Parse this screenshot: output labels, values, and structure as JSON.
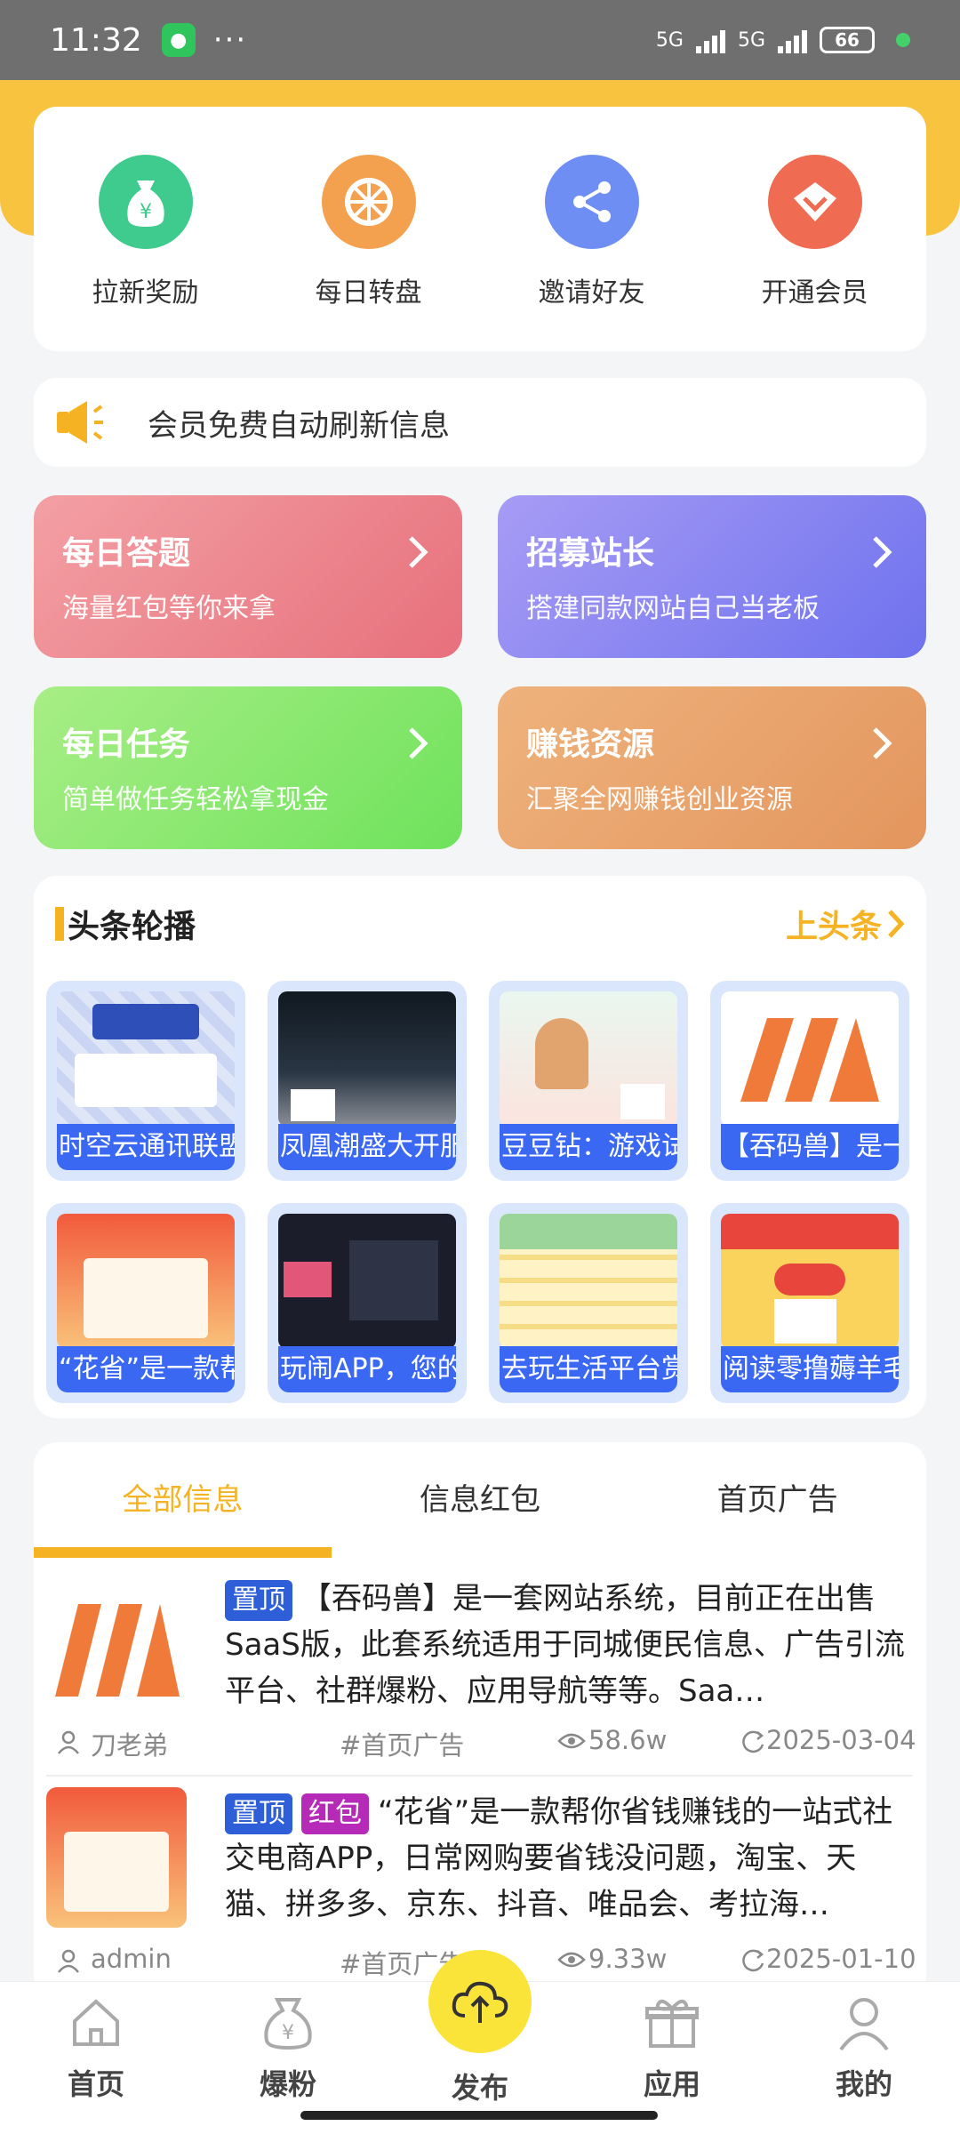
{
  "status": {
    "time": "11:32",
    "network1": "5G",
    "network2": "5G",
    "battery": "66"
  },
  "quick_actions": [
    {
      "label": "拉新奖励",
      "icon": "money-bag-icon",
      "color": "#3ecb8d"
    },
    {
      "label": "每日转盘",
      "icon": "wheel-icon",
      "color": "#f3a14e"
    },
    {
      "label": "邀请好友",
      "icon": "share-icon",
      "color": "#6f8ef3"
    },
    {
      "label": "开通会员",
      "icon": "diamond-icon",
      "color": "#ef6b52"
    }
  ],
  "notice": {
    "text": "会员免费自动刷新信息"
  },
  "tiles": [
    {
      "title": "每日答题",
      "subtitle": "海量红包等你来拿",
      "color": "#ee7f84"
    },
    {
      "title": "招募站长",
      "subtitle": "搭建同款网站自己当老板",
      "color": "#8c86f3"
    },
    {
      "title": "每日任务",
      "subtitle": "简单做任务轻松拿现金",
      "color": "#7ee267"
    },
    {
      "title": "赚钱资源",
      "subtitle": "汇聚全网赚钱创业资源",
      "color": "#e9a468"
    }
  ],
  "headline": {
    "title": "头条轮播",
    "more": "上头条",
    "items": [
      {
        "caption": "时空云通讯联盟"
      },
      {
        "caption": "凤凰潮盛大开服"
      },
      {
        "caption": "豆豆钻：游戏试玩"
      },
      {
        "caption": "【吞码兽】是一套"
      },
      {
        "caption": "“花省”是一款帮"
      },
      {
        "caption": "玩闹APP，您的"
      },
      {
        "caption": "去玩生活平台赏"
      },
      {
        "caption": "阅读零撸薅羊毛"
      }
    ]
  },
  "tabs": [
    {
      "label": "全部信息",
      "active": true
    },
    {
      "label": "信息红包",
      "active": false
    },
    {
      "label": "首页广告",
      "active": false
    }
  ],
  "posts": [
    {
      "badges": [
        "置顶"
      ],
      "text": "【吞码兽】是一套网站系统，目前正在出售SaaS版，此套系统适用于同城便民信息、广告引流平台、社群爆粉、应用导航等等。Saa…",
      "author": "刀老弟",
      "category": "#首页广告",
      "views": "58.6w",
      "date": "2025-03-04"
    },
    {
      "badges": [
        "置顶",
        "红包"
      ],
      "text": "“花省”是一款帮你省钱赚钱的一站式社交电商APP，日常网购要省钱没问题，淘宝、天猫、拼多多、京东、抖音、唯品会、考拉海…",
      "author": "admin",
      "category": "#首页广告",
      "views": "9.33w",
      "date": "2025-01-10"
    }
  ],
  "bottom_nav": [
    {
      "label": "首页",
      "icon": "home-icon"
    },
    {
      "label": "爆粉",
      "icon": "money-bag-icon"
    },
    {
      "label": "发布",
      "icon": "upload-cloud-icon"
    },
    {
      "label": "应用",
      "icon": "gift-icon"
    },
    {
      "label": "我的",
      "icon": "user-icon"
    }
  ]
}
